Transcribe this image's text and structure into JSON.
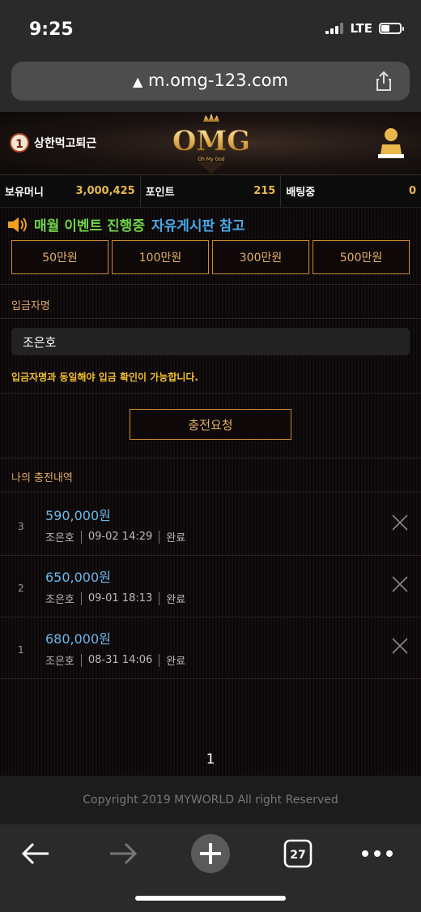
{
  "status_bar": {
    "time": "9:25",
    "network": "LTE"
  },
  "browser": {
    "url": "m.omg-123.com",
    "tab_count": "27"
  },
  "header": {
    "rank": "1",
    "username": "상한먹고퇴근",
    "logo_text": "OMG",
    "logo_sub": "Oh My God"
  },
  "balance": [
    {
      "label": "보유머니",
      "value": "3,000,425"
    },
    {
      "label": "포인트",
      "value": "215"
    },
    {
      "label": "배팅중",
      "value": "0"
    }
  ],
  "notice": {
    "part1": "매월 이벤트 진행중",
    "part2": "자유게시판 참고"
  },
  "amount_buttons": [
    "50만원",
    "100만원",
    "300만원",
    "500만원"
  ],
  "deposit": {
    "name_label": "입금자명",
    "name_value": "조은호",
    "warning": "입금자명과 동일해야 입금 확인이 가능합니다.",
    "request_label": "충전요청"
  },
  "history": {
    "title": "나의 충전내역",
    "items": [
      {
        "no": "3",
        "amount": "590,000원",
        "name": "조은호",
        "datetime": "09-02 14:29",
        "status": "완료"
      },
      {
        "no": "2",
        "amount": "650,000원",
        "name": "조은호",
        "datetime": "09-01 18:13",
        "status": "완료"
      },
      {
        "no": "1",
        "amount": "680,000원",
        "name": "조은호",
        "datetime": "08-31 14:06",
        "status": "완료"
      }
    ]
  },
  "pagination": {
    "current_page": "1"
  },
  "footer": {
    "copyright": "Copyright 2019 MYWORLD All right Reserved"
  },
  "colors": {
    "accent": "#d08a2e",
    "amount_blue": "#6ab8e8",
    "gold": "#e8b84a",
    "warning": "#f2c030"
  }
}
